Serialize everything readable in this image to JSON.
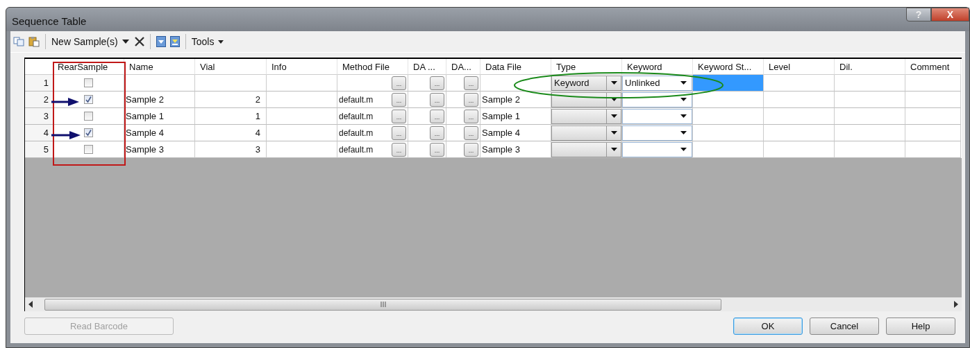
{
  "window": {
    "title": "Sequence Table",
    "help_glyph": "?",
    "close_glyph": "X"
  },
  "toolbar": {
    "new_samples": "New Sample(s)",
    "tools": "Tools"
  },
  "table": {
    "columns": [
      {
        "kind": "rownum"
      },
      {
        "label": "RearSample",
        "kind": "check"
      },
      {
        "label": "Name",
        "kind": "text"
      },
      {
        "label": "Vial",
        "kind": "number"
      },
      {
        "label": "Info",
        "kind": "text"
      },
      {
        "label": "Method File",
        "kind": "browse",
        "browse": "..."
      },
      {
        "label": "DA ...",
        "kind": "browse",
        "browse": "..."
      },
      {
        "label": "DA...",
        "kind": "browse",
        "browse": "..."
      },
      {
        "label": "Data File",
        "kind": "text"
      },
      {
        "label": "Type",
        "kind": "typecombo"
      },
      {
        "label": "Keyword",
        "kind": "combo"
      },
      {
        "label": "Keyword St...",
        "kind": "status"
      },
      {
        "label": "Level",
        "kind": "text"
      },
      {
        "label": "Dil.",
        "kind": "text"
      },
      {
        "label": "Comment",
        "kind": "text"
      }
    ],
    "rows": [
      {
        "n": "1",
        "rear_sample": false,
        "type": "Keyword",
        "keyword": "Unlinked",
        "keyword_status_selected": true
      },
      {
        "n": "2",
        "rear_sample": true,
        "name": "Sample 2",
        "vial": "2",
        "method_file": "default.m",
        "data_file": "Sample 2",
        "keyword_status_selected": false
      },
      {
        "n": "3",
        "rear_sample": false,
        "name": "Sample 1",
        "vial": "1",
        "method_file": "default.m",
        "data_file": "Sample 1",
        "keyword_status_selected": false
      },
      {
        "n": "4",
        "rear_sample": true,
        "name": "Sample 4",
        "vial": "4",
        "method_file": "default.m",
        "data_file": "Sample 4",
        "keyword_status_selected": false
      },
      {
        "n": "5",
        "rear_sample": false,
        "name": "Sample 3",
        "vial": "3",
        "method_file": "default.m",
        "data_file": "Sample 3",
        "keyword_status_selected": false
      }
    ]
  },
  "buttons": [
    {
      "label": "Read Barcode",
      "disabled": true,
      "default": false
    },
    {
      "label": "OK",
      "disabled": false,
      "default": true
    },
    {
      "label": "Cancel",
      "disabled": false,
      "default": false
    },
    {
      "label": "Help",
      "disabled": false,
      "default": false
    }
  ]
}
